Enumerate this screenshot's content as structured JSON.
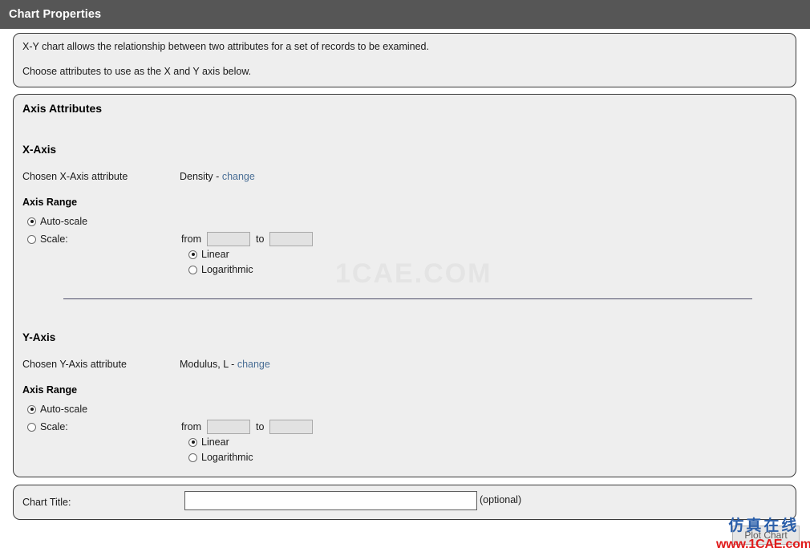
{
  "window": {
    "title": "Chart Properties"
  },
  "description": {
    "line1": "X-Y chart allows the relationship between two attributes for a set of records to be examined.",
    "line2": "Choose attributes to use as the X and Y axis below."
  },
  "axis_attributes": {
    "heading": "Axis Attributes",
    "x_axis": {
      "heading": "X-Axis",
      "chosen_label": "Chosen X-Axis attribute",
      "chosen_value": "Density",
      "separator": "-",
      "change_link": "change",
      "range_heading": "Axis Range",
      "auto_scale_label": "Auto-scale",
      "auto_scale_selected": true,
      "scale_label": "Scale:",
      "scale_selected": false,
      "from_label": "from",
      "from_value": "",
      "to_label": "to",
      "to_value": "",
      "linear_label": "Linear",
      "linear_selected": true,
      "logarithmic_label": "Logarithmic",
      "logarithmic_selected": false
    },
    "y_axis": {
      "heading": "Y-Axis",
      "chosen_label": "Chosen Y-Axis attribute",
      "chosen_value": "Modulus, L",
      "separator": "-",
      "change_link": "change",
      "range_heading": "Axis Range",
      "auto_scale_label": "Auto-scale",
      "auto_scale_selected": true,
      "scale_label": "Scale:",
      "scale_selected": false,
      "from_label": "from",
      "from_value": "",
      "to_label": "to",
      "to_value": "",
      "linear_label": "Linear",
      "linear_selected": true,
      "logarithmic_label": "Logarithmic",
      "logarithmic_selected": false
    }
  },
  "chart_title": {
    "label": "Chart Title:",
    "value": "",
    "placeholder": "",
    "optional_note": "(optional)"
  },
  "actions": {
    "plot_chart": "Plot Chart"
  },
  "watermarks": {
    "center": "1CAE.COM",
    "bottom_chinese": "仿真在线",
    "bottom_url": "www.1CAE.com"
  },
  "colors": {
    "titlebar_bg": "#565656",
    "panel_bg": "#eeeeee",
    "panel_border": "#3a3a3a",
    "link": "#4a6f96",
    "watermark_blue": "#2b5faa",
    "watermark_red": "#e01b1b"
  }
}
